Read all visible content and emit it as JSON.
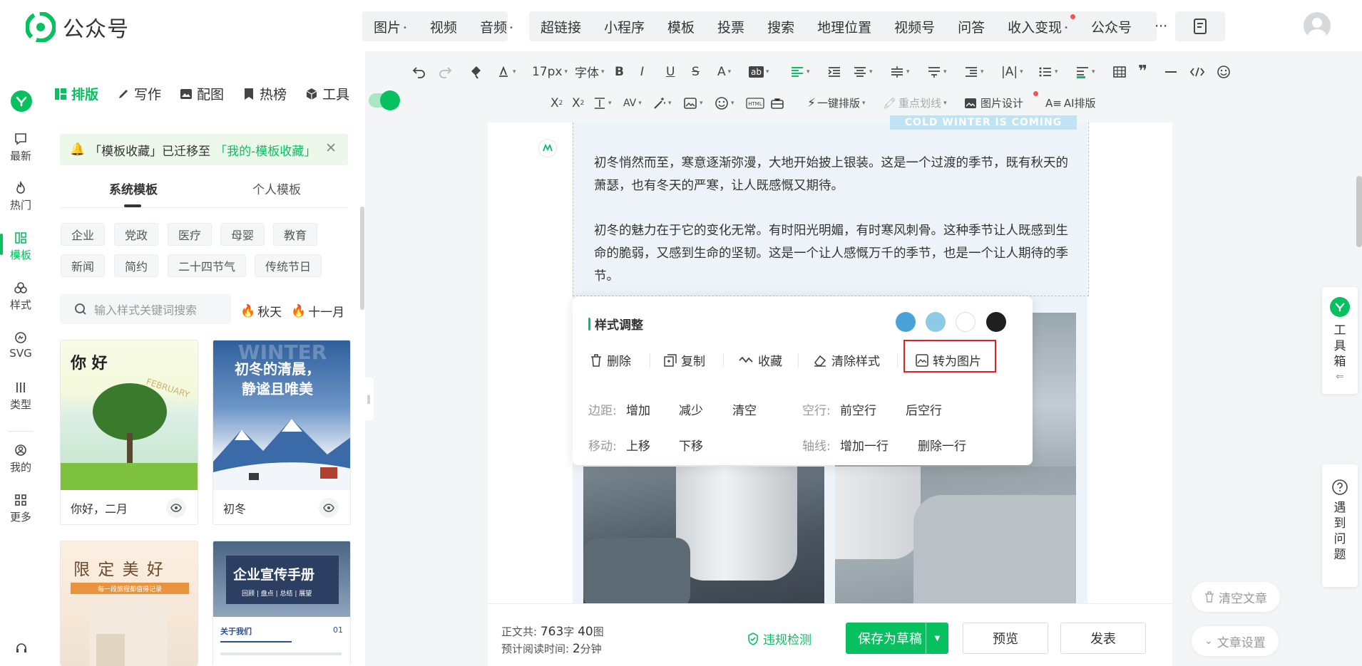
{
  "app": {
    "title": "公众号"
  },
  "top_menu": {
    "media": [
      "图片",
      "视频",
      "音频"
    ],
    "media_has_caret": [
      true,
      false,
      true
    ],
    "insert": [
      "超链接",
      "小程序",
      "模板",
      "投票",
      "搜索",
      "地理位置",
      "视频号",
      "问答",
      "收入变现",
      "公众号"
    ],
    "more": "···"
  },
  "panel_tabs": [
    "排版",
    "写作",
    "配图",
    "热榜",
    "工具"
  ],
  "left_nav": [
    {
      "label": "最新",
      "icon": "news-icon"
    },
    {
      "label": "热门",
      "icon": "flame-icon"
    },
    {
      "label": "模板",
      "icon": "template-icon"
    },
    {
      "label": "样式",
      "icon": "style-icon"
    },
    {
      "label": "SVG",
      "icon": "svg-icon"
    },
    {
      "label": "类型",
      "icon": "columns-icon"
    },
    {
      "label": "我的",
      "icon": "user-icon"
    },
    {
      "label": "更多",
      "icon": "grid-icon"
    }
  ],
  "notice": {
    "text": "「模板收藏」已迁移至",
    "link": "「我的-模板收藏」"
  },
  "template_tabs": [
    "系统模板",
    "个人模板"
  ],
  "categories_row1": [
    "企业",
    "党政",
    "医疗",
    "母婴",
    "教育"
  ],
  "categories_row2": [
    "新闻",
    "简约",
    "二十四节气",
    "传统节日"
  ],
  "search": {
    "placeholder": "输入样式关键词搜索"
  },
  "hot_tags": [
    "秋天",
    "十一月"
  ],
  "templates": [
    {
      "name": "你好，二月",
      "thumb_title": "你 好",
      "thumb_sub": "FEBRUARY"
    },
    {
      "name": "初冬",
      "thumb_title": "初冬的清晨，",
      "thumb_title2": "静谧且唯美",
      "thumb_sub": "WINTER"
    },
    {
      "thumb_title": "限 定 美 好",
      "thumb_sub": "每一段旅程都值得记录"
    },
    {
      "thumb_title": "企业宣传手册",
      "thumb_sub": "回顾 | 盘点 | 总结 | 展望",
      "thumb_about": "关于我们",
      "thumb_num": "01"
    }
  ],
  "toolbar": {
    "font_size": "17px",
    "font": "字体",
    "one_click": "一键排版",
    "highlight": "重点划线",
    "image_design": "图片设计",
    "ai_layout": "AI排版"
  },
  "editor": {
    "banner": "COLD WINTER IS COMING",
    "paragraphs": [
      "初冬悄然而至，寒意逐渐弥漫，大地开始披上银装。这是一个过渡的季节，既有秋天的萧瑟，也有冬天的严寒，让人既感慨又期待。",
      "初冬的魅力在于它的变化无常。有时阳光明媚，有时寒风刺骨。这种季节让人既感到生命的脆弱，又感到生命的坚韧。这是一个让人感慨万千的季节，也是一个让人期待的季节。"
    ]
  },
  "popup": {
    "title": "样式调整",
    "swatches": [
      "#4aa3d8",
      "#8ecae6",
      "#ffffff",
      "#1f1f1f"
    ],
    "actions": [
      "删除",
      "复制",
      "收藏",
      "清除样式",
      "转为图片"
    ],
    "margin_label": "边距:",
    "margin_opts": [
      "增加",
      "减少",
      "清空"
    ],
    "line_label": "空行:",
    "line_opts": [
      "前空行",
      "后空行"
    ],
    "move_label": "移动:",
    "move_opts": [
      "上移",
      "下移"
    ],
    "axis_label": "轴线:",
    "axis_opts": [
      "增加一行",
      "删除一行"
    ]
  },
  "footer": {
    "count_label": "正文共:",
    "char_count": "763",
    "char_unit": "字",
    "img_count": "40",
    "img_unit": "图",
    "read_label": "预计阅读时间:",
    "read_time": "2",
    "read_unit": "分钟",
    "check": "违规检测",
    "save": "保存为草稿",
    "preview": "预览",
    "publish": "发表"
  },
  "right": {
    "toolbox": "工具箱",
    "help": "遇到问题",
    "clear": "清空文章",
    "settings": "文章设置"
  },
  "colors": {
    "brand": "#07c160",
    "highlight_border": "#e02020"
  }
}
